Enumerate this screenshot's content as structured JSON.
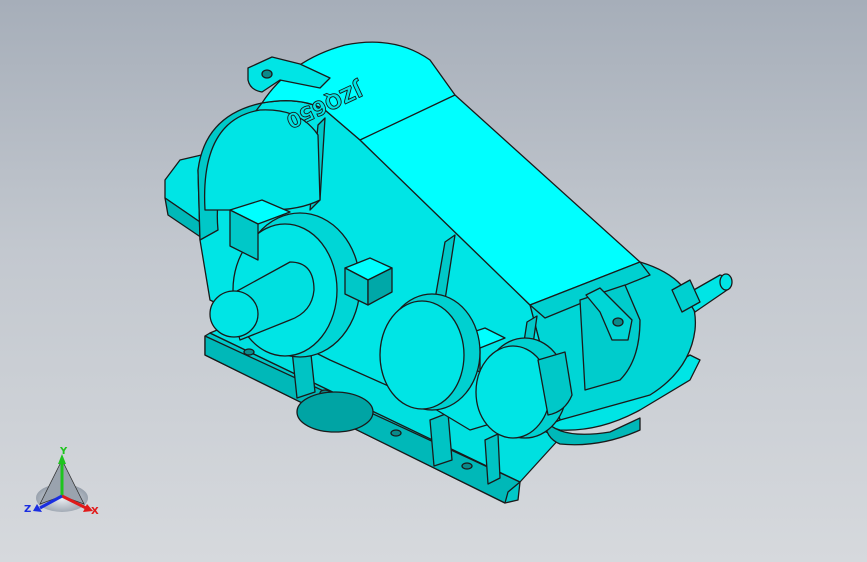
{
  "model": {
    "engraved_text": "JZQ650",
    "body_color": "#00e5e5",
    "shade_color": "#00b3b3",
    "edge_color": "#1a1a1a"
  },
  "triad": {
    "x_label": "X",
    "y_label": "Y",
    "z_label": "Z",
    "x_color": "#e11a1a",
    "y_color": "#1ec41e",
    "z_color": "#1a2ee1"
  },
  "background": {
    "top_color": "#a6aeb9",
    "bottom_color": "#d6d9dd"
  }
}
